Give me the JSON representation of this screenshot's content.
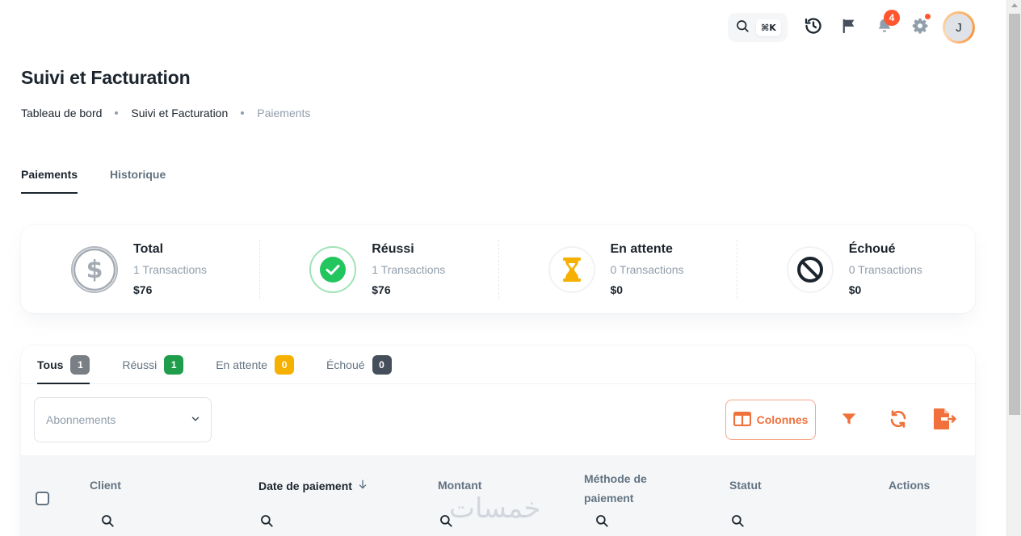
{
  "topbar": {
    "search_shortcut": "⌘K",
    "notifications_count": "4",
    "avatar_initial": "J"
  },
  "page": {
    "title": "Suivi et Facturation",
    "breadcrumb": [
      "Tableau de bord",
      "Suivi et Facturation",
      "Paiements"
    ]
  },
  "main_tabs": [
    {
      "label": "Paiements",
      "active": true
    },
    {
      "label": "Historique",
      "active": false
    }
  ],
  "stats": [
    {
      "title": "Total",
      "subtitle": "1 Transactions",
      "value": "$76",
      "icon": "dollar-icon",
      "color": "#a4abb3"
    },
    {
      "title": "Réussi",
      "subtitle": "1 Transactions",
      "value": "$76",
      "icon": "check-circle-icon",
      "color": "#22c55e"
    },
    {
      "title": "En attente",
      "subtitle": "0 Transactions",
      "value": "$0",
      "icon": "hourglass-icon",
      "color": "#f5b000"
    },
    {
      "title": "Échoué",
      "subtitle": "0 Transactions",
      "value": "$0",
      "icon": "ban-icon",
      "color": "#1c252e"
    }
  ],
  "status_tabs": [
    {
      "label": "Tous",
      "count": "1",
      "color": "#7a7f85",
      "active": true
    },
    {
      "label": "Réussi",
      "count": "1",
      "color": "#1f9d4a",
      "active": false
    },
    {
      "label": "En attente",
      "count": "0",
      "color": "#f5b000",
      "active": false
    },
    {
      "label": "Échoué",
      "count": "0",
      "color": "#454f5b",
      "active": false
    }
  ],
  "filters": {
    "subscription_placeholder": "Abonnements",
    "columns_label": "Colonnes"
  },
  "table": {
    "headers": {
      "client": "Client",
      "date": "Date de paiement",
      "amount": "Montant",
      "method_line1": "Méthode de",
      "method_line2": "paiement",
      "status": "Statut",
      "actions": "Actions"
    }
  },
  "watermark": "خمسات",
  "colors": {
    "accent": "#f0713c",
    "primary_text": "#1c252e",
    "muted_text": "#919eab"
  }
}
